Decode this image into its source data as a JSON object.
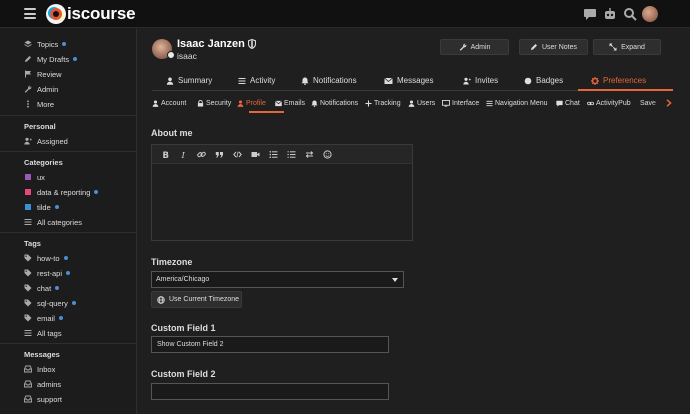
{
  "header": {
    "logo_text": "iscourse",
    "icons": [
      "chat-icon",
      "robot-icon",
      "search-icon",
      "user-avatar"
    ]
  },
  "sidebar": {
    "top_items": [
      {
        "label": "Topics",
        "icon": "layers-icon",
        "dot": true
      },
      {
        "label": "My Drafts",
        "icon": "pencil-icon",
        "dot": true
      },
      {
        "label": "Review",
        "icon": "flag-icon",
        "dot": false
      },
      {
        "label": "Admin",
        "icon": "wrench-icon",
        "dot": false
      },
      {
        "label": "More",
        "icon": "more-icon",
        "dot": false
      }
    ],
    "personal_header": "Personal",
    "personal_items": [
      {
        "label": "Assigned",
        "icon": "user-plus-icon"
      }
    ],
    "categories_header": "Categories",
    "categories": [
      {
        "label": "ux",
        "color": "#9b59b6",
        "dot": false
      },
      {
        "label": "data & reporting",
        "color": "#e8457a",
        "dot": true
      },
      {
        "label": "tilde",
        "color": "#3b8fd8",
        "dot": true
      },
      {
        "label": "All categories",
        "icon": "list-icon",
        "dot": false
      }
    ],
    "tags_header": "Tags",
    "tags": [
      {
        "label": "how-to",
        "dot": true
      },
      {
        "label": "rest-api",
        "dot": true
      },
      {
        "label": "chat",
        "dot": true
      },
      {
        "label": "sql-query",
        "dot": true
      },
      {
        "label": "email",
        "dot": true
      },
      {
        "label": "All tags",
        "icon": "list-icon",
        "dot": false
      }
    ],
    "messages_header": "Messages",
    "messages": [
      {
        "label": "Inbox"
      },
      {
        "label": "admins"
      },
      {
        "label": "support"
      }
    ]
  },
  "user": {
    "name": "Isaac Janzen",
    "handle": "isaac"
  },
  "actions": {
    "admin": "Admin",
    "user_notes": "User Notes",
    "expand": "Expand"
  },
  "tabs": [
    "Summary",
    "Activity",
    "Notifications",
    "Messages",
    "Invites",
    "Badges",
    "Preferences"
  ],
  "subtabs": [
    "Account",
    "Security",
    "Profile",
    "Emails",
    "Notifications",
    "Tracking",
    "Users",
    "Interface",
    "Navigation Menu",
    "Chat",
    "ActivityPub",
    "Save"
  ],
  "form": {
    "about_label": "About me",
    "timezone_label": "Timezone",
    "timezone_value": "America/Chicago",
    "use_current_tz": "Use Current Timezone",
    "custom1_label": "Custom Field 1",
    "custom1_value": "Show Custom Field 2",
    "custom2_label": "Custom Field 2",
    "custom2_value": ""
  },
  "colors": {
    "accent": "#e5663a",
    "unread_dot": "#4a8fd1"
  }
}
